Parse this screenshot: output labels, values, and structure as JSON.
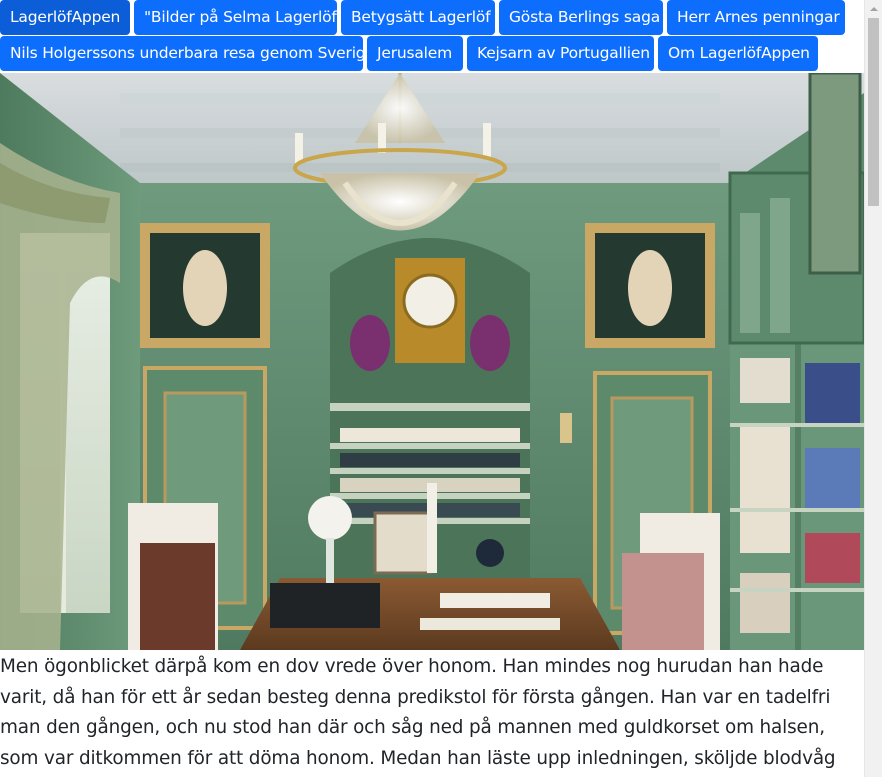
{
  "nav": {
    "items": [
      {
        "label": "LagerlöfAppen",
        "active": true
      },
      {
        "label": "\"Bilder på Selma Lagerlöf",
        "active": false
      },
      {
        "label": "Betygsätt Lagerlöf",
        "active": false
      },
      {
        "label": "Gösta Berlings saga",
        "active": false
      },
      {
        "label": "Herr Arnes penningar",
        "active": false
      },
      {
        "label": "Nils Holgerssons underbara resa genom Sverige",
        "active": false
      },
      {
        "label": "Jerusalem",
        "active": false
      },
      {
        "label": "Kejsarn av Portugallien",
        "active": false
      },
      {
        "label": "Om LagerlöfAppen",
        "active": false
      }
    ],
    "color": "#0d6efd"
  },
  "hero": {
    "image_icon": "study-room-photo"
  },
  "story": {
    "text": "Men ögonblicket därpå kom en dov vrede över honom. Han mindes nog hurudan han hade varit, då han för ett år sedan besteg denna predikstol för första gången. Han var en tadelfri man den gången, och nu stod han där och såg ned på mannen med guldkorset om halsen, som var ditkommen för att döma honom. Medan han läste upp inledningen, sköljde blodvåg efter"
  }
}
